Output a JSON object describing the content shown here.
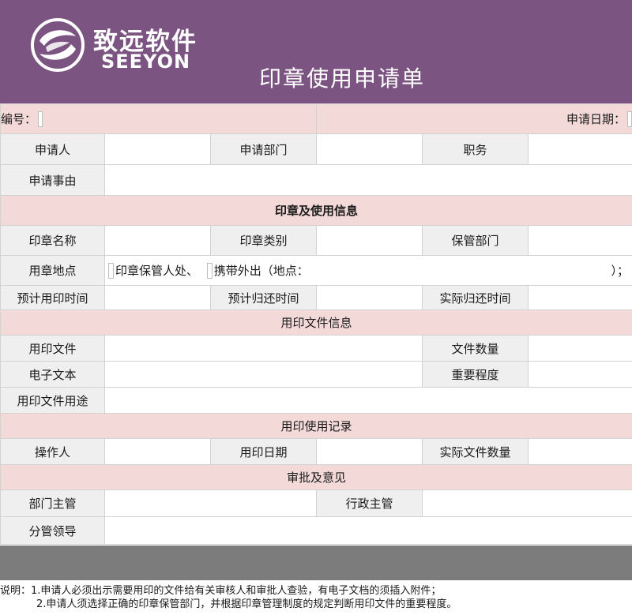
{
  "brand": {
    "name_cn": "致远软件",
    "name_en": "SEEYON",
    "colors": {
      "header": "#7b5482",
      "section": "#f3d9d8",
      "label": "#efefef",
      "footer_bar": "#7c7c7c"
    }
  },
  "form": {
    "title": "印章使用申请单",
    "serial_label": "编号：",
    "date_label": "申请日期："
  },
  "applicant": {
    "applicant_label": "申请人",
    "dept_label": "申请部门",
    "position_label": "职务",
    "reason_label": "申请事由"
  },
  "seal_section": {
    "title": "印章及使用信息",
    "seal_name_label": "印章名称",
    "seal_type_label": "印章类别",
    "custody_dept_label": "保管部门",
    "location_label": "用章地点",
    "option_keeper": "印章保管人处、",
    "option_outside": "携带外出（地点：",
    "option_end": "）；",
    "est_use_time_label": "预计用印时间",
    "est_return_label": "预计归还时间",
    "actual_return_label": "实际归还时间"
  },
  "document_section": {
    "title": "用印文件信息",
    "doc_label": "用印文件",
    "doc_count_label": "文件数量",
    "electronic_label": "电子文本",
    "importance_label": "重要程度",
    "purpose_label": "用印文件用途"
  },
  "record_section": {
    "title": "用印使用记录",
    "operator_label": "操作人",
    "use_date_label": "用印日期",
    "actual_count_label": "实际文件数量"
  },
  "approval_section": {
    "title": "审批及意见",
    "dept_manager_label": "部门主管",
    "admin_manager_label": "行政主管",
    "leader_label": "分管领导"
  },
  "notes": {
    "line1": "说明：1.申请人必须出示需要用印的文件给有关审核人和审批人查验，有电子文档的须插入附件；",
    "line2": "2.申请人须选择正确的印章保管部门，并根据印章管理制度的规定判断用印文件的重要程度。"
  }
}
